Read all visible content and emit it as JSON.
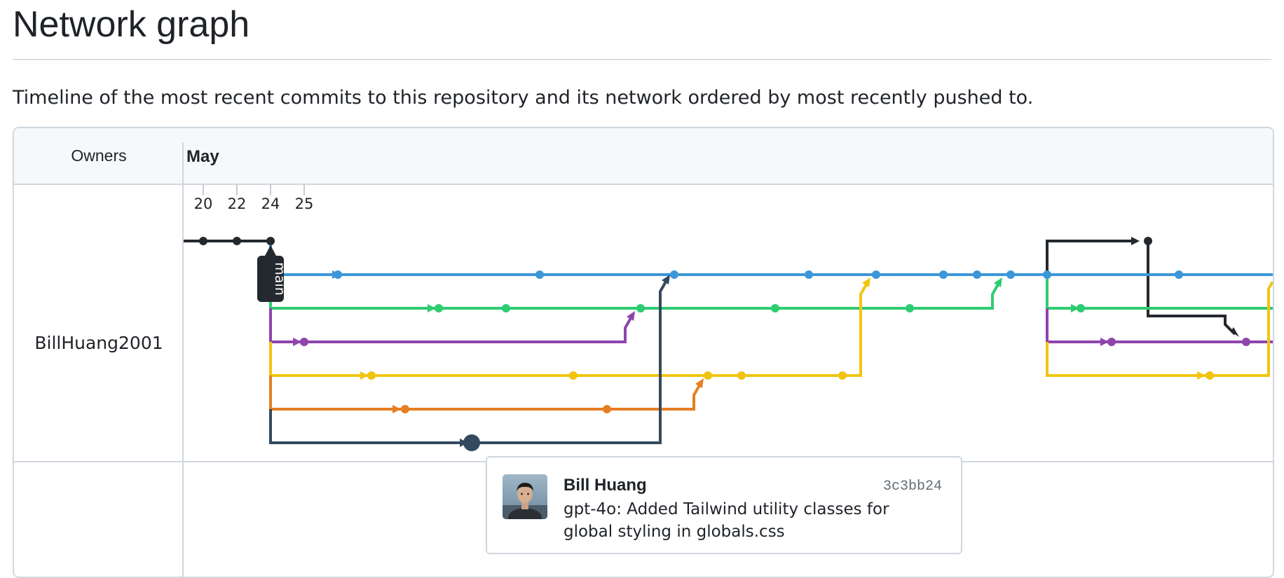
{
  "page": {
    "title": "Network graph",
    "description": "Timeline of the most recent commits to this repository and its network ordered by most recently pushed to."
  },
  "graph": {
    "owners_heading": "Owners",
    "month_label": "May",
    "day_labels": [
      "20",
      "22",
      "24",
      "25"
    ],
    "owner": "BillHuang2001",
    "branch_label": "main",
    "branch_colors": {
      "main": "#24292f",
      "blue": "#3b97d8",
      "green": "#2ecc71",
      "purple": "#8e44ad",
      "yellow": "#f1c40f",
      "orange": "#e67e22",
      "slate": "#34495e"
    }
  },
  "tooltip": {
    "author": "Bill Huang",
    "sha": "3c3bb24",
    "message": "gpt-4o: Added Tailwind utility classes for global styling in globals.css"
  }
}
